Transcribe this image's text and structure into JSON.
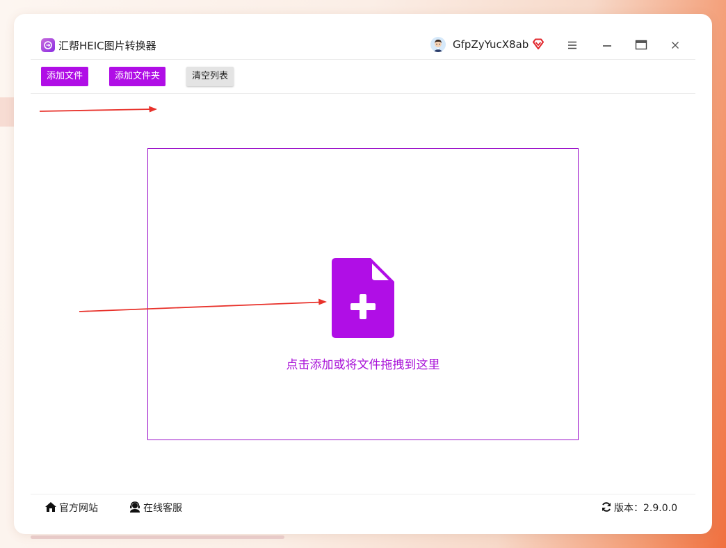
{
  "window": {
    "app_title": "汇帮HEIC图片转换器",
    "username": "GfpZyYucX8ab"
  },
  "toolbar": {
    "add_file_label": "添加文件",
    "add_folder_label": "添加文件夹",
    "clear_list_label": "清空列表"
  },
  "dropzone": {
    "hint": "点击添加或将文件拖拽到这里"
  },
  "footer": {
    "website_label": "官方网站",
    "support_label": "在线客服",
    "version_label": "版本：2.9.0.0"
  },
  "icons": {
    "logo": "app-logo-icon",
    "avatar": "user-avatar",
    "vip": "vip-diamond-icon",
    "menu": "menu-icon",
    "minimize": "minimize-icon",
    "maximize": "maximize-icon",
    "close": "close-icon",
    "add_file": "file-add-icon",
    "home": "home-icon",
    "support": "headset-icon",
    "refresh": "refresh-icon"
  },
  "colors": {
    "accent": "#b00ee6",
    "drop_border": "#9a10c9",
    "hint_text": "#a912d8",
    "annotation_arrow": "#e8312a",
    "vip": "#e1262b"
  }
}
